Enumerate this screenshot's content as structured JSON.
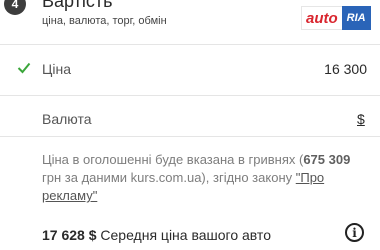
{
  "section": {
    "number": "4",
    "title": "Вартість",
    "subtitle": "ціна, валюта, торг, обмін"
  },
  "logo": {
    "part1": "auto",
    "part2": "RIA",
    "colors": {
      "red": "#d9262f",
      "blue": "#2a64b8"
    }
  },
  "price": {
    "label": "Ціна",
    "value": "16 300",
    "status_icon": "check-icon",
    "status_color": "#3aa63a"
  },
  "currency": {
    "label": "Валюта",
    "value": "$"
  },
  "note": {
    "text_before": "Ціна в оголошенні буде вказана в гривнях (",
    "uah_amount": "675 309",
    "text_after": " грн за даними kurs.com.ua), згідно закону ",
    "link": "\"Про рекламу\""
  },
  "average": {
    "amount": "17 628 $",
    "label": " Середня ціна вашого авто",
    "info_icon": "info-icon"
  }
}
